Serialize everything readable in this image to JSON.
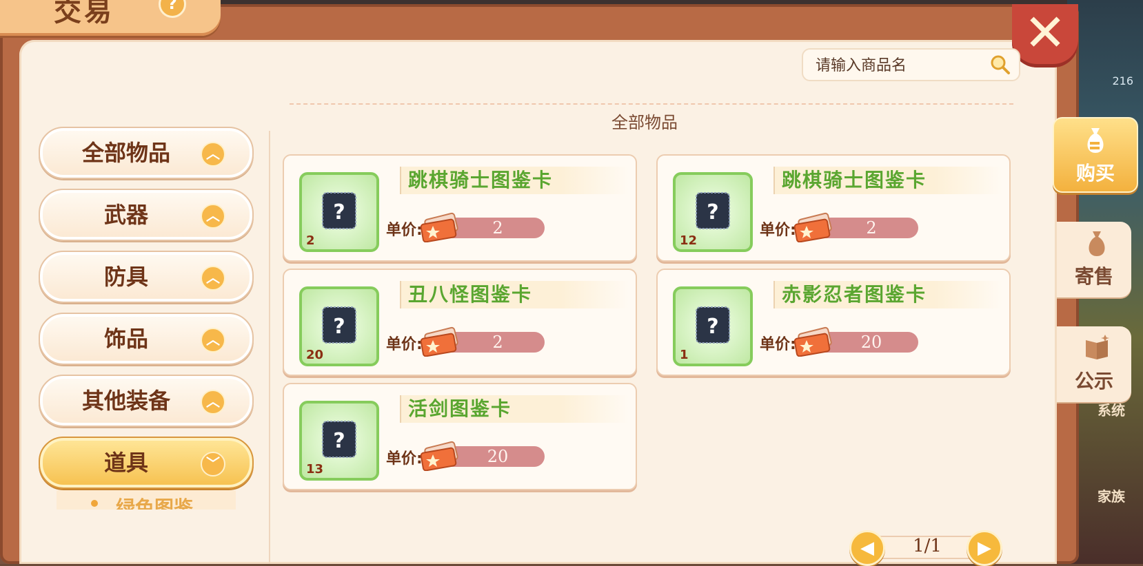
{
  "window": {
    "title": "交易",
    "help_label": "?",
    "close_label": "✕"
  },
  "background": {
    "number": "216",
    "text1": "系统",
    "text2": "家族"
  },
  "search": {
    "placeholder": "请输入商品名",
    "icon": "search-icon"
  },
  "section_title": "全部物品",
  "categories": [
    {
      "label": "全部物品",
      "expanded": false
    },
    {
      "label": "武器",
      "expanded": false
    },
    {
      "label": "防具",
      "expanded": false
    },
    {
      "label": "饰品",
      "expanded": false
    },
    {
      "label": "其他装备",
      "expanded": false
    },
    {
      "label": "道具",
      "expanded": true
    }
  ],
  "subcategory": {
    "label": "绿色图鉴"
  },
  "price_label": "单价:",
  "items": [
    {
      "name": "跳棋骑士图鉴卡",
      "qty": "2",
      "price": "2"
    },
    {
      "name": "跳棋骑士图鉴卡",
      "qty": "12",
      "price": "2"
    },
    {
      "name": "丑八怪图鉴卡",
      "qty": "20",
      "price": "2"
    },
    {
      "name": "赤影忍者图鉴卡",
      "qty": "1",
      "price": "20"
    },
    {
      "name": "活剑图鉴卡",
      "qty": "13",
      "price": "20"
    }
  ],
  "side_tabs": [
    {
      "label": "购买",
      "icon": "money-bag-icon",
      "active": true
    },
    {
      "label": "寄售",
      "icon": "sack-icon",
      "active": false
    },
    {
      "label": "公示",
      "icon": "book-icon",
      "active": false
    }
  ],
  "pager": {
    "text": "1/1",
    "prev": "◀",
    "next": "▶"
  },
  "colors": {
    "frame": "#b86a45",
    "panel": "#fbf1e4",
    "item_name": "#5aa630",
    "active_tab": "#f3b13e",
    "close": "#c9473a"
  }
}
